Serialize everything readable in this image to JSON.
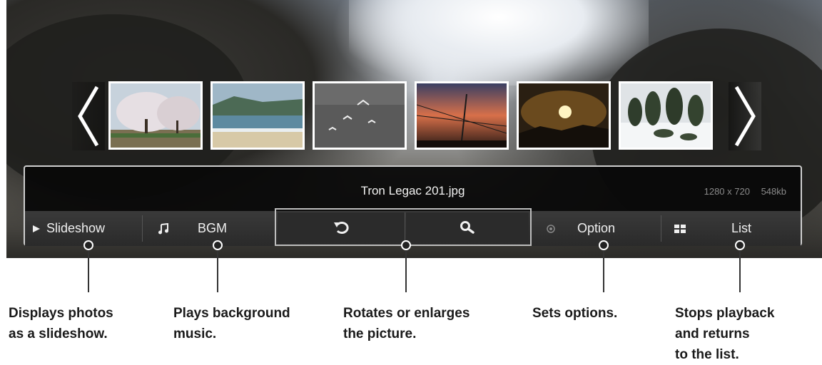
{
  "filmstrip": {
    "thumbnails": [
      {
        "subject": "cherry-blossom-trees"
      },
      {
        "subject": "beach-shoreline"
      },
      {
        "subject": "seagulls-over-water"
      },
      {
        "subject": "sunset-power-lines"
      },
      {
        "subject": "sun-over-hills"
      },
      {
        "subject": "snowy-garden"
      }
    ]
  },
  "info": {
    "filename": "Tron Legac 201.jpg",
    "resolution": "1280 x 720",
    "size": "548kb"
  },
  "controls": {
    "slideshow_label": "Slideshow",
    "bgm_label": "BGM",
    "option_label": "Option",
    "list_label": "List"
  },
  "callouts": {
    "slideshow": "Displays photos\nas a slideshow.",
    "bgm": "Plays background\nmusic.",
    "rotate_zoom": "Rotates or enlarges\nthe picture.",
    "option": "Sets options.",
    "list": "Stops playback\nand returns\nto the list."
  },
  "colors": {
    "panel_bg": "#0a0a0a",
    "button_bar": "#333333",
    "panel_border": "#cfcfcf",
    "callout_text": "#1a1a1a"
  }
}
